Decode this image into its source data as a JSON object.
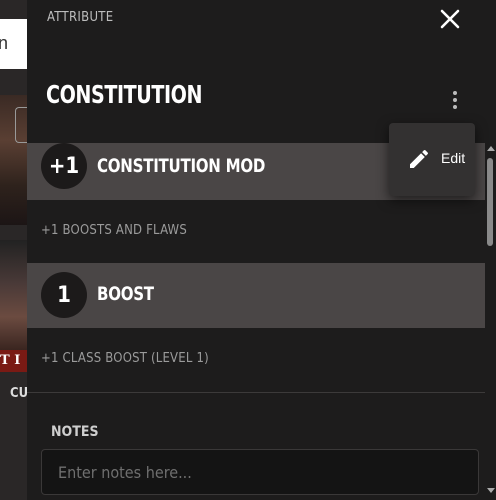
{
  "background": {
    "search_text": "n",
    "banner_text": "T I",
    "label": "CU"
  },
  "panel": {
    "header_label": "ATTRIBUTE",
    "title": "CONSTITUTION",
    "rows": [
      {
        "badge": "+1",
        "name": "CONSTITUTION MOD",
        "sub": "+1 BOOSTS AND FLAWS"
      },
      {
        "badge": "1",
        "name": "BOOST",
        "sub": "+1 CLASS BOOST (LEVEL 1)"
      }
    ],
    "notes": {
      "label": "NOTES",
      "placeholder": "Enter notes here...",
      "value": ""
    }
  },
  "menu": {
    "items": [
      {
        "label": "Edit",
        "icon": "pencil-icon"
      }
    ]
  },
  "icons": {
    "close": "close-icon",
    "more": "kebab-menu-icon"
  },
  "colors": {
    "panel_bg": "#1d1c1c",
    "row_bg": "#4a4646",
    "badge_bg": "#1c1a1a",
    "menu_bg": "#333131"
  }
}
